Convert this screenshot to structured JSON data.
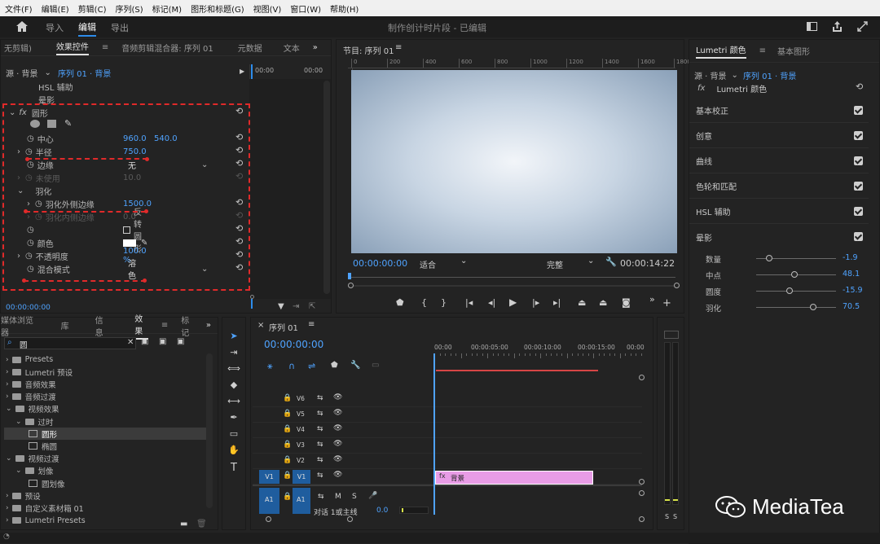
{
  "menu": [
    "文件(F)",
    "编辑(E)",
    "剪辑(C)",
    "序列(S)",
    "标记(M)",
    "图形和标题(G)",
    "视图(V)",
    "窗口(W)",
    "帮助(H)"
  ],
  "workspace": {
    "tabs": [
      "导入",
      "编辑",
      "导出"
    ],
    "title": "制作创计时片段 - 已编辑"
  },
  "effects_controls": {
    "tabs": [
      "无剪辑)",
      "效果控件",
      "音频剪辑混合器: 序列 01",
      "元数据",
      "文本"
    ],
    "source": "源 · 背景",
    "clip": "序列 01 · 背景",
    "ruler_a": "00:00",
    "ruler_b": "00:00",
    "hsl": "HSL 辅助",
    "vignette": "晕影",
    "mask": "圆形",
    "center_label": "中心",
    "center_x": "960.0",
    "center_y": "540.0",
    "radius_label": "半径",
    "radius": "750.0",
    "edge_label": "边缘",
    "edge": "无",
    "unused_label": "未使用",
    "unused": "10.0",
    "feather_label": "羽化",
    "feather_out_label": "羽化外侧边缘",
    "feather_out": "1500.0",
    "feather_in_label": "羽化内侧边缘",
    "feather_in": "0.0",
    "invert_label": "反转圆形",
    "color_label": "颜色",
    "opacity_label": "不透明度",
    "opacity": "100.0 %",
    "blend_label": "混合模式",
    "blend": "溶色",
    "timecode": "00:00:00:00"
  },
  "program": {
    "title": "节目: 序列 01",
    "ruler": [
      "0",
      "200",
      "400",
      "600",
      "800",
      "1000",
      "1200",
      "1400",
      "1600",
      "1800"
    ],
    "timecode": "00:00:00:00",
    "fit": "适合",
    "quality": "完整",
    "duration": "00:00:14:22"
  },
  "lumetri": {
    "tabs": [
      "Lumetri 颜色",
      "基本图形"
    ],
    "source": "源 · 背景",
    "clip": "序列 01 · 背景",
    "effect": "Lumetri 颜色",
    "sections": [
      "基本校正",
      "创意",
      "曲线",
      "色轮和匹配",
      "HSL 辅助",
      "晕影"
    ],
    "vignette_params": [
      {
        "label": "数量",
        "value": "-1.9",
        "pos": 0.16
      },
      {
        "label": "中点",
        "value": "48.1",
        "pos": 0.48
      },
      {
        "label": "圆度",
        "value": "-15.9",
        "pos": 0.42
      },
      {
        "label": "羽化",
        "value": "70.5",
        "pos": 0.71
      }
    ]
  },
  "project": {
    "tabs": [
      "媒体浏览器",
      "库",
      "信息",
      "效果",
      "标记"
    ],
    "search": "圆",
    "items": [
      {
        "label": "Presets",
        "level": 0
      },
      {
        "label": "Lumetri 预设",
        "level": 0
      },
      {
        "label": "音频效果",
        "level": 0
      },
      {
        "label": "音频过渡",
        "level": 0
      },
      {
        "label": "视频效果",
        "level": 0
      },
      {
        "label": "过时",
        "level": 1
      },
      {
        "label": "圆形",
        "level": 2
      },
      {
        "label": "椭圆",
        "level": 2
      },
      {
        "label": "视频过渡",
        "level": 0
      },
      {
        "label": "划像",
        "level": 1
      },
      {
        "label": "圆划像",
        "level": 2
      },
      {
        "label": "预设",
        "level": 0
      },
      {
        "label": "自定义素材箱 01",
        "level": 0
      },
      {
        "label": "Lumetri Presets",
        "level": 0
      }
    ]
  },
  "timeline": {
    "title": "序列 01",
    "timecode": "00:00:00:00",
    "ruler": [
      "00:00",
      "00:00:05:00",
      "00:00:10:00",
      "00:00:15:00",
      "00:00"
    ],
    "video_tracks": [
      "V6",
      "V5",
      "V4",
      "V3",
      "V2",
      "V1"
    ],
    "src_v": "V1",
    "src_a": "A1",
    "audio_track": "A1",
    "audio_mix": "对话 1或主线",
    "audio_level": "0.0",
    "clip": "背景"
  },
  "watermark": "MediaTea",
  "meter": [
    "S",
    "S"
  ],
  "colors": {
    "accent": "#2d8ceb",
    "clip": "#e89ce6",
    "dashed": "#e02a2a"
  }
}
